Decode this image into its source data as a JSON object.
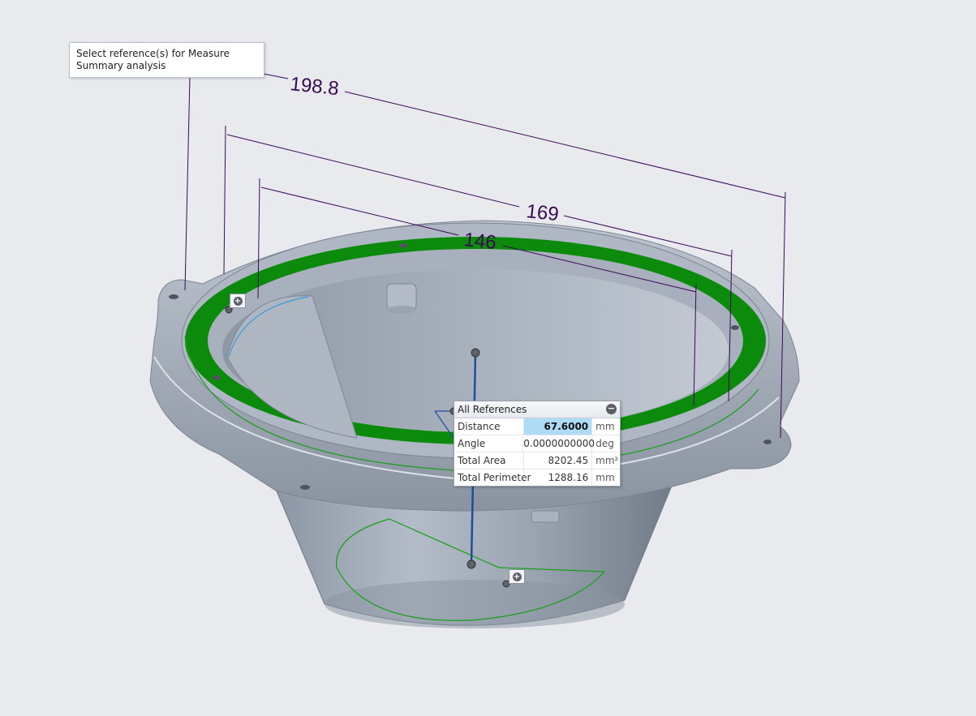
{
  "prompt": {
    "text": "Select reference(s) for Measure Summary analysis"
  },
  "dimensions": {
    "outer": "198.8",
    "middle": "169",
    "inner": "146"
  },
  "measure_panel": {
    "title": "All References",
    "collapse_symbol": "−",
    "rows": [
      {
        "label": "Distance",
        "value": "67.6000",
        "unit": "mm"
      },
      {
        "label": "Angle",
        "value": "0.0000000000",
        "unit": "deg"
      },
      {
        "label": "Total Area",
        "value": "8202.45",
        "unit": "mm²"
      },
      {
        "label": "Total Perimeter",
        "value": "1288.16",
        "unit": "mm"
      }
    ]
  },
  "plus_symbol": "+",
  "colors": {
    "background": "#e8eaee",
    "part_gray": "#9aa4b2",
    "selected_surface": "#0c8a0c",
    "dimension": "#3a0a55",
    "measure_axis": "#1b4f9c",
    "highlight": "#aedcf7"
  }
}
